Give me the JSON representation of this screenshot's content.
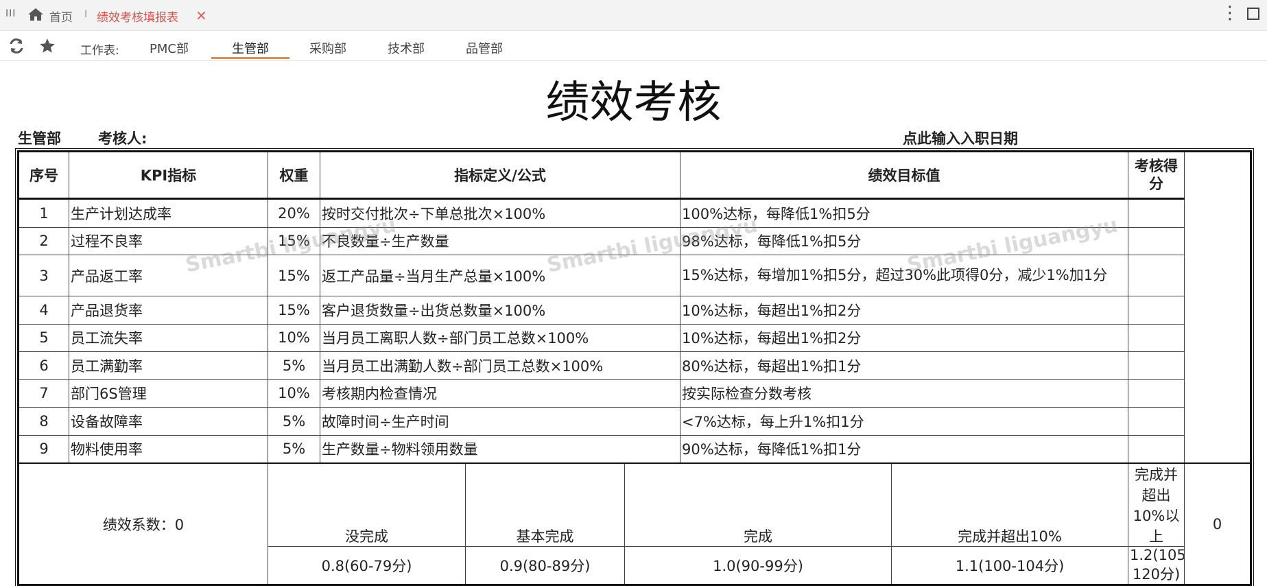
{
  "topbar": {
    "menu_glyph": "III",
    "home_label": "首页",
    "separator": "I",
    "active_tab": "绩效考核填报表",
    "close_glyph": "×",
    "more_glyph": "⋮"
  },
  "sheetbar": {
    "label": "工作表:",
    "tabs": [
      "PMC部",
      "生管部",
      "采购部",
      "技术部",
      "品管部"
    ],
    "active_tab": "生管部"
  },
  "report": {
    "title": "绩效考核",
    "department": "生管部",
    "assessor_label": "考核人:",
    "date_hint": "点此输入入职日期",
    "headers": [
      "序号",
      "KPI指标",
      "权重",
      "指标定义/公式",
      "绩效目标值",
      "考核得分"
    ],
    "rows": [
      {
        "no": "1",
        "kpi": "生产计划达成率",
        "weight": "20%",
        "formula": "按时交付批次÷下单总批次×100%",
        "target": "100%达标，每降低1%扣5分",
        "score": ""
      },
      {
        "no": "2",
        "kpi": "过程不良率",
        "weight": "15%",
        "formula": "不良数量÷生产数量",
        "target": "98%达标，每降低1%扣5分",
        "score": ""
      },
      {
        "no": "3",
        "kpi": "产品返工率",
        "weight": "15%",
        "formula": "返工产品量÷当月生产总量×100%",
        "target": "15%达标，每增加1%扣5分，超过30%此项得0分，减少1%加1分",
        "score": ""
      },
      {
        "no": "4",
        "kpi": "产品退货率",
        "weight": "15%",
        "formula": "客户退货数量÷出货总数量×100%",
        "target": "10%达标，每超出1%扣2分",
        "score": ""
      },
      {
        "no": "5",
        "kpi": "员工流失率",
        "weight": "10%",
        "formula": "当月员工离职人数÷部门员工总数×100%",
        "target": "10%达标，每超出1%扣2分",
        "score": ""
      },
      {
        "no": "6",
        "kpi": "员工满勤率",
        "weight": "5%",
        "formula": "当月员工出满勤人数÷部门员工总数×100%",
        "target": "80%达标，每超出1%扣1分",
        "score": ""
      },
      {
        "no": "7",
        "kpi": "部门6S管理",
        "weight": "10%",
        "formula": "考核期内检查情况",
        "target": "按实际检查分数考核",
        "score": ""
      },
      {
        "no": "8",
        "kpi": "设备故障率",
        "weight": "5%",
        "formula": "故障时间÷生产时间",
        "target": "<7%达标，每上升1%扣1分",
        "score": ""
      },
      {
        "no": "9",
        "kpi": "物料使用率",
        "weight": "5%",
        "formula": "生产数量÷物料领用数量",
        "target": "90%达标，每降低1%扣1分",
        "score": ""
      }
    ],
    "coefficient_label": "绩效系数：0",
    "grades": [
      {
        "name": "没完成",
        "value": "0.8(60-79分)"
      },
      {
        "name": "基本完成",
        "value": "0.9(80-89分)"
      },
      {
        "name": "完成",
        "value": "1.0(90-99分)"
      },
      {
        "name": "完成并超出10%",
        "value": "1.1(100-104分)"
      },
      {
        "name": "完成并超出10%以上",
        "value": "1.2(105-120分)"
      }
    ],
    "total_score": "0",
    "watermark": "Smartbi liguangyu"
  }
}
